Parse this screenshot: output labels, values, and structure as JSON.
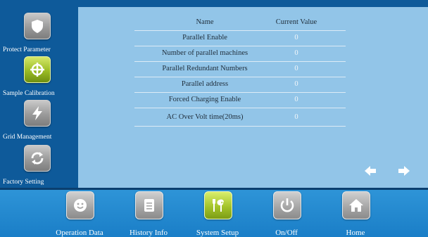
{
  "sidebar": {
    "items": [
      {
        "label": "Protect Parameter",
        "icon": "shield-icon"
      },
      {
        "label": "Sample Calibration",
        "icon": "crosshair-icon"
      },
      {
        "label": "Grid Management",
        "icon": "lightning-icon"
      },
      {
        "label": "Factory Setting",
        "icon": "refresh-icon"
      }
    ]
  },
  "table": {
    "headers": {
      "name": "Name",
      "value": "Current Value"
    },
    "rows": [
      {
        "name": "Parallel Enable",
        "value": "0"
      },
      {
        "name": "Number of parallel machines",
        "value": "0"
      },
      {
        "name": "Parallel Redundant Numbers",
        "value": "0"
      },
      {
        "name": "Parallel address",
        "value": "0"
      },
      {
        "name": "Forced Charging Enable",
        "value": "0"
      },
      {
        "name": "AC Over Volt time(20ms)",
        "value": "0"
      }
    ]
  },
  "nav": {
    "tabs": [
      {
        "label": "Operation Data",
        "icon": "smiley-icon"
      },
      {
        "label": "History Info",
        "icon": "document-icon"
      },
      {
        "label": "System Setup",
        "icon": "tools-icon"
      },
      {
        "label": "On/Off",
        "icon": "power-icon"
      },
      {
        "label": "Home",
        "icon": "home-icon"
      }
    ]
  },
  "colors": {
    "sidebar_bg": "#0e5a9a",
    "content_bg": "#92c5e8",
    "bottom_bar": "#1a7ec7",
    "active_accent": "#a4c42a"
  }
}
